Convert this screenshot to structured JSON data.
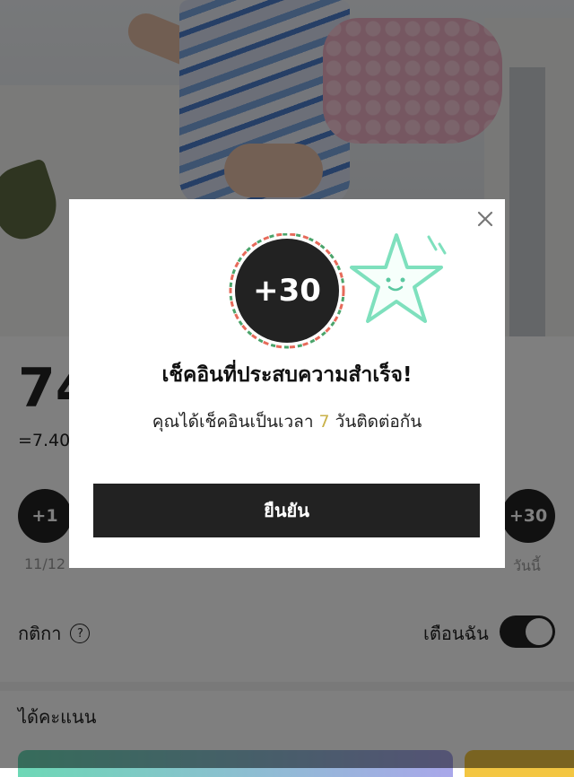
{
  "main": {
    "total_points": "74",
    "conversion_text": "=7.40",
    "days": [
      {
        "value": "+1",
        "date": "11/12"
      },
      {
        "value": "+30",
        "date": "วันนี้"
      }
    ],
    "rules_label": "กติกา",
    "help_icon": "?",
    "remind_label": "เตือนฉัน",
    "remind_enabled": true,
    "points_section_title": "ได้คะแนน"
  },
  "modal": {
    "badge": "+30",
    "title": "เช็คอินที่ประสบความสำเร็จ!",
    "message_prefix": "คุณได้เช็คอินเป็นเวลา ",
    "message_days": "7",
    "message_suffix": " วันติดต่อกัน",
    "confirm_label": "ยืนยัน",
    "icons": [
      "close-icon",
      "star-mascot-icon"
    ]
  },
  "colors": {
    "overlay": "rgba(0,0,0,0.5)",
    "button_bg": "#222222",
    "highlight": "#c9b24a",
    "star": "#7ee0bd"
  }
}
